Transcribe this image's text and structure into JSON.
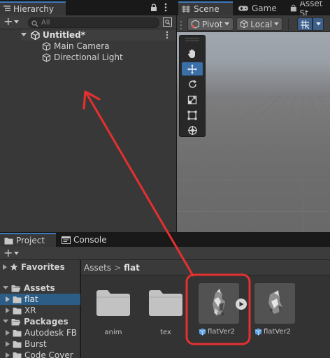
{
  "hierarchy": {
    "tab_label": "Hierarchy",
    "search_placeholder": "All",
    "add_label": "+",
    "scene_name": "Untitled*",
    "items": [
      {
        "label": "Main Camera"
      },
      {
        "label": "Directional Light"
      }
    ]
  },
  "scene": {
    "tabs": [
      {
        "label": "Scene"
      },
      {
        "label": "Game"
      },
      {
        "label": "Asset St"
      }
    ],
    "pivot_label": "Pivot",
    "local_label": "Local"
  },
  "project": {
    "tabs": [
      {
        "label": "Project"
      },
      {
        "label": "Console"
      }
    ],
    "add_label": "+",
    "favorites_label": "Favorites",
    "assets_label": "Assets",
    "asset_children": [
      {
        "label": "flat"
      },
      {
        "label": "XR"
      }
    ],
    "packages_label": "Packages",
    "package_children": [
      {
        "label": "Autodesk FB"
      },
      {
        "label": "Burst"
      },
      {
        "label": "Code Cover"
      }
    ],
    "breadcrumb": {
      "root": "Assets",
      "separator": ">",
      "current": "flat"
    },
    "grid_items": [
      {
        "label": "anim",
        "kind": "folder"
      },
      {
        "label": "tex",
        "kind": "folder"
      },
      {
        "label": "flatVer2",
        "kind": "model"
      },
      {
        "label": "flatVer2",
        "kind": "model"
      }
    ]
  },
  "annotation": {
    "arrow_color": "#e53030"
  }
}
